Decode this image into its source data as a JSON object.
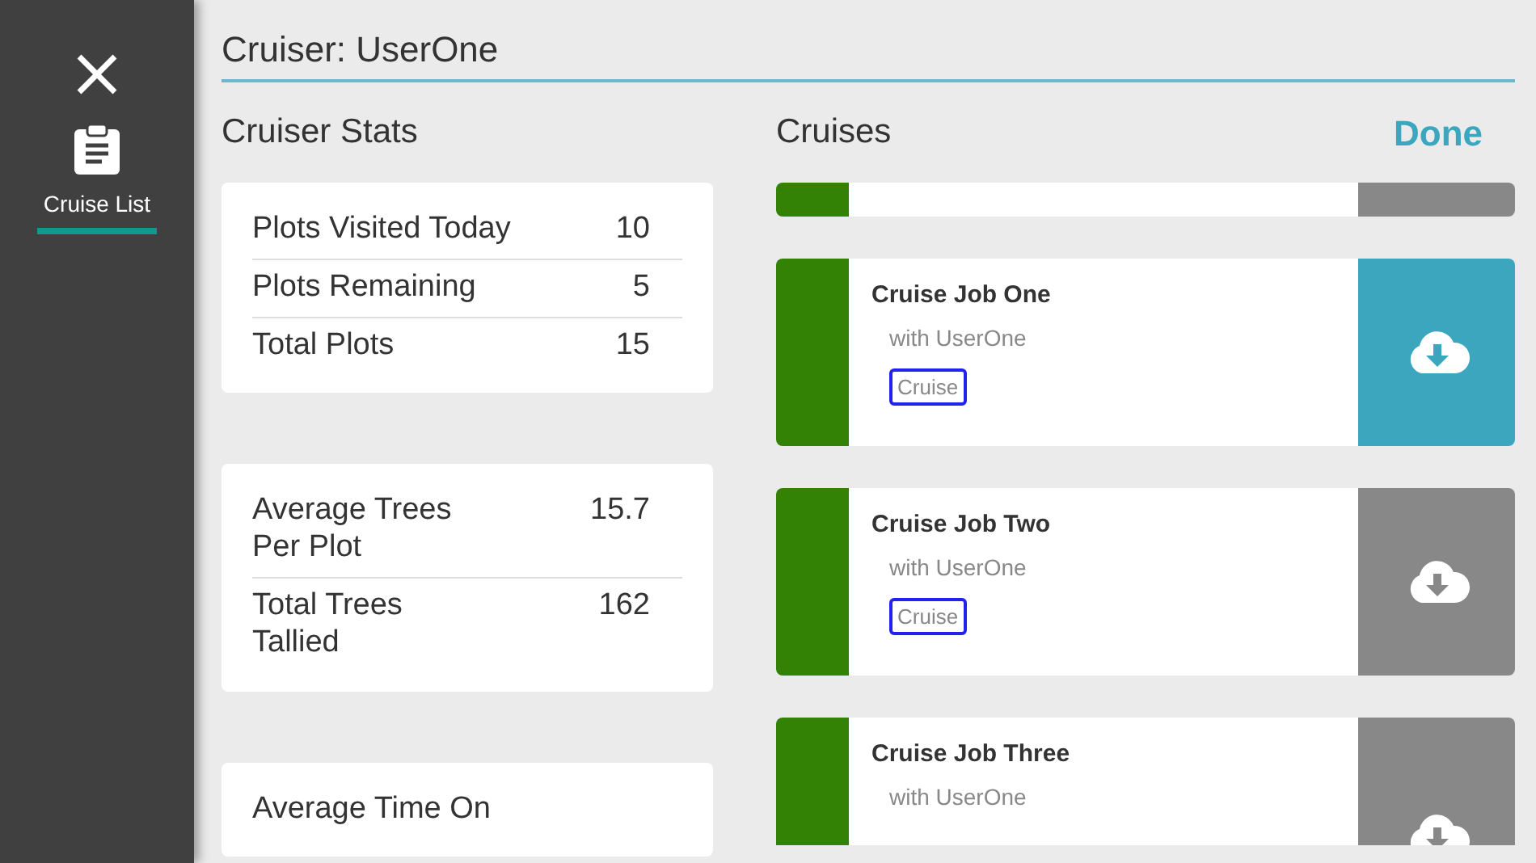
{
  "sidebar": {
    "items": [
      {
        "label": "Cruise List",
        "selected": true
      }
    ]
  },
  "header": {
    "title": "Cruiser: UserOne"
  },
  "stats": {
    "heading": "Cruiser Stats",
    "cards": [
      {
        "rows": [
          {
            "label": "Plots Visited Today",
            "value": "10"
          },
          {
            "label": "Plots Remaining",
            "value": "5"
          },
          {
            "label": "Total Plots",
            "value": "15"
          }
        ]
      },
      {
        "rows": [
          {
            "label": "Average Trees Per Plot",
            "value": "15.7"
          },
          {
            "label": "Total Trees Tallied",
            "value": "162"
          }
        ]
      },
      {
        "rows": [
          {
            "label": "Average Time On",
            "value": ""
          }
        ]
      }
    ]
  },
  "cruises": {
    "heading": "Cruises",
    "done": "Done",
    "jobs": [
      {
        "kind": "partial",
        "selected": false
      },
      {
        "kind": "full",
        "title": "Cruise Job One",
        "subtitle": "with UserOne",
        "tag": "Cruise",
        "selected": true
      },
      {
        "kind": "full",
        "title": "Cruise Job Two",
        "subtitle": "with UserOne",
        "tag": "Cruise",
        "selected": false
      },
      {
        "kind": "full",
        "title": "Cruise Job Three",
        "subtitle": "with UserOne",
        "selected": false
      }
    ]
  }
}
